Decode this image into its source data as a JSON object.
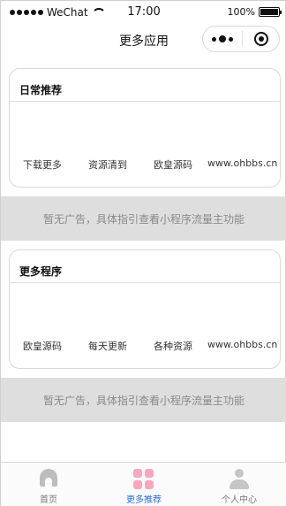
{
  "status_bar": {
    "carrier": "WeChat",
    "time": "17:00",
    "battery": "100%"
  },
  "nav": {
    "title": "更多应用"
  },
  "sections": [
    {
      "title": "日常推荐",
      "apps": [
        "下载更多",
        "资源清到",
        "欧皇源码",
        "www.ohbbs.cn"
      ]
    },
    {
      "title": "更多程序",
      "apps": [
        "欧皇源码",
        "每天更新",
        "各种资源",
        "www.ohbbs.cn"
      ]
    }
  ],
  "ads": [
    "暂无广告，具体指引查看小程序流量主功能",
    "暂无广告，具体指引查看小程序流量主功能"
  ],
  "tabbar": {
    "active_color": "#2d6bd6",
    "items": [
      {
        "label": "首页",
        "icon": "home-icon"
      },
      {
        "label": "更多推荐",
        "icon": "grid-icon"
      },
      {
        "label": "个人中心",
        "icon": "user-icon"
      }
    ]
  }
}
